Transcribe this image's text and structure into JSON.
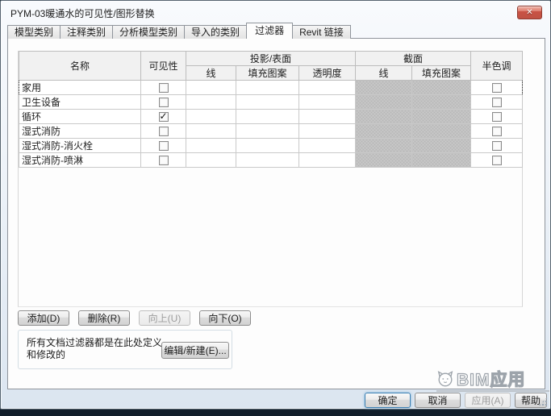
{
  "window": {
    "title": "PYM-03暖通水的可见性/图形替换"
  },
  "icons": {
    "close": "✕",
    "check": "✓"
  },
  "tabs": [
    {
      "id": "model-categories",
      "label": "模型类别",
      "active": false
    },
    {
      "id": "annotation-categories",
      "label": "注释类别",
      "active": false
    },
    {
      "id": "analytical-model-categories",
      "label": "分析模型类别",
      "active": false
    },
    {
      "id": "imported-categories",
      "label": "导入的类别",
      "active": false
    },
    {
      "id": "filters",
      "label": "过滤器",
      "active": true
    },
    {
      "id": "revit-links",
      "label": "Revit 链接",
      "active": false
    }
  ],
  "filter_table": {
    "headers": {
      "name": "名称",
      "visibility": "可见性",
      "projection": "投影/表面",
      "projection_lines": "线",
      "projection_patterns": "填充图案",
      "transparency": "透明度",
      "cut": "截面",
      "cut_lines": "线",
      "cut_patterns": "填充图案",
      "halftone": "半色调"
    },
    "rows": [
      {
        "name": "家用",
        "visible": false,
        "halftone": false,
        "focused": true
      },
      {
        "name": "卫生设备",
        "visible": false,
        "halftone": false,
        "focused": false
      },
      {
        "name": "循环",
        "visible": true,
        "halftone": false,
        "focused": false
      },
      {
        "name": "湿式消防",
        "visible": false,
        "halftone": false,
        "focused": false
      },
      {
        "name": "湿式消防-消火栓",
        "visible": false,
        "halftone": false,
        "focused": false
      },
      {
        "name": "湿式消防-喷淋",
        "visible": false,
        "halftone": false,
        "focused": false
      }
    ]
  },
  "actions": {
    "add": "添加(D)",
    "remove": "删除(R)",
    "up": "向上(U)",
    "down": "向下(O)",
    "up_enabled": false
  },
  "edit_group": {
    "description": "所有文档过滤器都是在此处定义和修改的",
    "edit_new_label": "编辑/新建(E)..."
  },
  "footer": {
    "ok": "确定",
    "cancel": "取消",
    "apply": "应用(A)",
    "help": "帮助",
    "apply_enabled": false
  },
  "watermark": {
    "text": "BIM应用"
  }
}
